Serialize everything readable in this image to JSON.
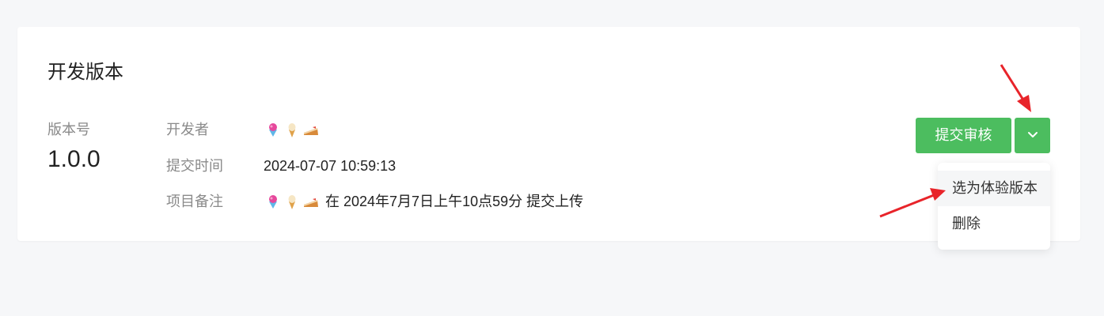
{
  "card": {
    "title": "开发版本",
    "version_label": "版本号",
    "version_value": "1.0.0",
    "fields": {
      "developer_label": "开发者",
      "submit_time_label": "提交时间",
      "submit_time_value": "2024-07-07 10:59:13",
      "note_label": "项目备注",
      "note_text": "在 2024年7月7日上午10点59分 提交上传"
    },
    "developer_icons": [
      "shaved-ice-icon",
      "ice-cream-icon",
      "cake-icon"
    ]
  },
  "actions": {
    "submit_label": "提交审核",
    "more_icon": "chevron-down-icon"
  },
  "dropdown": {
    "items": [
      "选为体验版本",
      "删除"
    ]
  },
  "colors": {
    "primary": "#4cbd5f",
    "annotation_arrow": "#e8242a",
    "page_bg": "#f6f7f9"
  }
}
